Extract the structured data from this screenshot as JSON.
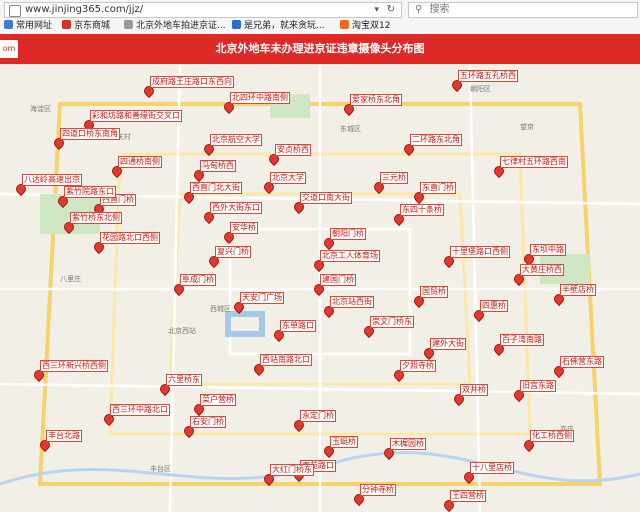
{
  "browser": {
    "url": "www.jinjing365.com/jjz/",
    "search_placeholder": "搜索",
    "bookmarks": [
      "常用网址",
      "京东商城",
      "北京外地车拍进京证...",
      "是兄弟，就来贪玩...",
      "淘宝双12"
    ]
  },
  "page": {
    "tag": "om",
    "title": "北京外地车未办理进京证违章摄像头分布图"
  },
  "map": {
    "cameras": [
      "成府路王庄路口东西向",
      "彩和坊路和善缘街交叉口",
      "北四环中路南侧",
      "爱家桥东北角",
      "五环路五孔桥西",
      "四道口桥东南角",
      "北京航空大学",
      "安贞桥西",
      "二环路东北角",
      "七律村五环路西南",
      "四通桥南侧",
      "八达岭高速出京",
      "马甸桥西",
      "西直门北大街",
      "东直门桥",
      "北京大学",
      "西直门桥",
      "交道口南大街",
      "东四十条桥",
      "朝阳门桥",
      "三元桥",
      "十里堡路口西侧",
      "紫竹院路东口",
      "西外大街东口",
      "安华桥",
      "北京工人体育场",
      "东坝中路",
      "大黄庄桥西",
      "半壁店桥",
      "紫竹桥东北侧",
      "复兴门桥",
      "建国门桥",
      "国贸桥",
      "四惠桥",
      "百子湾南路",
      "石佛营东路",
      "花园路北口西侧",
      "阜成门桥",
      "崇文门桥东",
      "天安门广场",
      "东单路口",
      "北京站西街",
      "建外大街",
      "西站南路北口",
      "菜户营桥",
      "右安门桥",
      "永定门桥",
      "玉蜓桥",
      "夕照寺桥",
      "双井桥",
      "西三环新兴桥西侧",
      "西三环中路北口",
      "六里桥东",
      "丰台北路",
      "南苑路口",
      "木樨园桥",
      "大红门桥东",
      "分钟寺桥",
      "十八里店桥",
      "王四营桥",
      "化工桥西侧",
      "旧宫东路"
    ],
    "places": [
      "中关村",
      "八里庄",
      "北京西站",
      "丰台区",
      "朝阳区",
      "海淀区",
      "东城区",
      "西城区",
      "亦庄",
      "望京"
    ]
  }
}
